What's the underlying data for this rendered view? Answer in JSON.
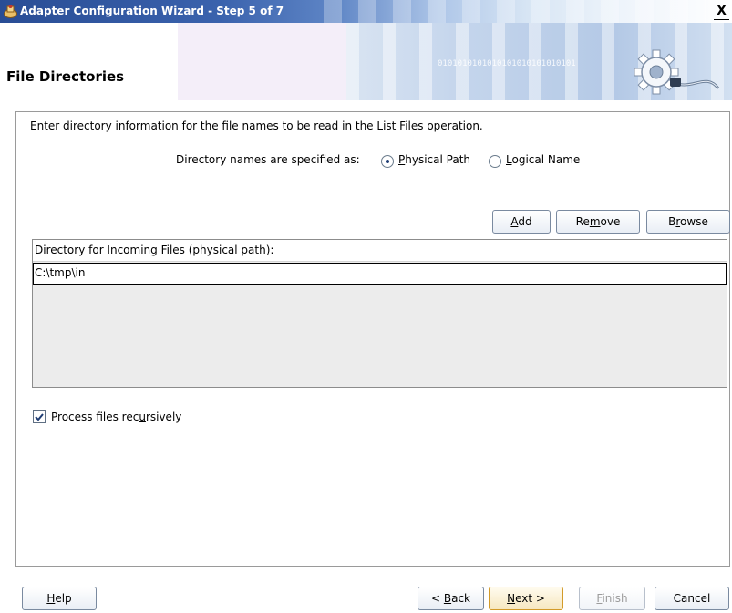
{
  "window": {
    "title": "Adapter Configuration Wizard - Step 5 of 7",
    "close_glyph": "X"
  },
  "banner": {
    "title": "File Directories",
    "decoration_text": "0101010101010101010101010101",
    "icon": "gear-plug-icon"
  },
  "content": {
    "intro": "Enter directory information for the file names to be read in the List Files operation.",
    "spec_label": "Directory names are specified as:",
    "options": [
      {
        "label": "Physical Path",
        "selected": true
      },
      {
        "label": "Logical Name",
        "selected": false
      }
    ]
  },
  "table_buttons": {
    "add": "Add",
    "remove": "Remove",
    "browse": "Browse"
  },
  "directory_table": {
    "header": "Directory for Incoming Files (physical path):",
    "rows": [
      "C:\\tmp\\in"
    ]
  },
  "recursive": {
    "label": "Process files recursively",
    "checked": true
  },
  "footer": {
    "help": "Help",
    "back": "< Back",
    "next": "Next >",
    "finish": "Finish",
    "cancel": "Cancel"
  },
  "colors": {
    "titlebar_start": "#294d95",
    "focus_border": "#d39b2a",
    "disabled_text": "#9c9c9c"
  }
}
